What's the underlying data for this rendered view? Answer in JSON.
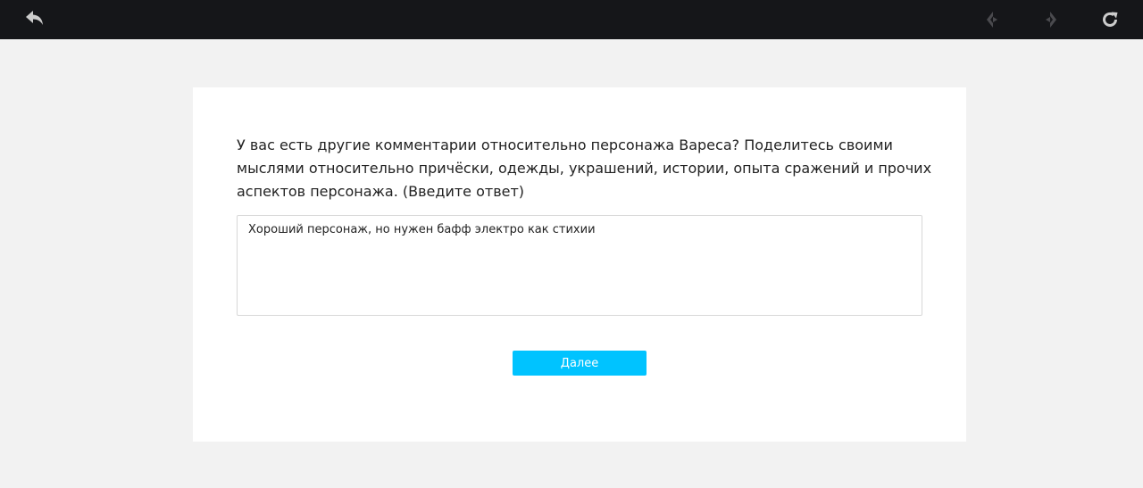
{
  "toolbar": {
    "back_icon": "back-arrow-icon",
    "prev_icon": "prev-arrow-icon",
    "next_icon": "next-arrow-icon",
    "refresh_icon": "refresh-icon",
    "icon_color": "#cccccc",
    "disabled_icon_color": "#4a4a4e",
    "background": "#151619"
  },
  "survey": {
    "question": "У вас есть другие комментарии относительно персонажа Вареса? Поделитесь своими мыслями относительно причёски, одежды, украшений, истории, опыта сражений и прочих аспектов персонажа.  (Введите ответ)",
    "answer": "Хороший персонаж, но нужен бафф электро как стихии",
    "next_label": "Далее",
    "accent": "#00c3ff"
  }
}
